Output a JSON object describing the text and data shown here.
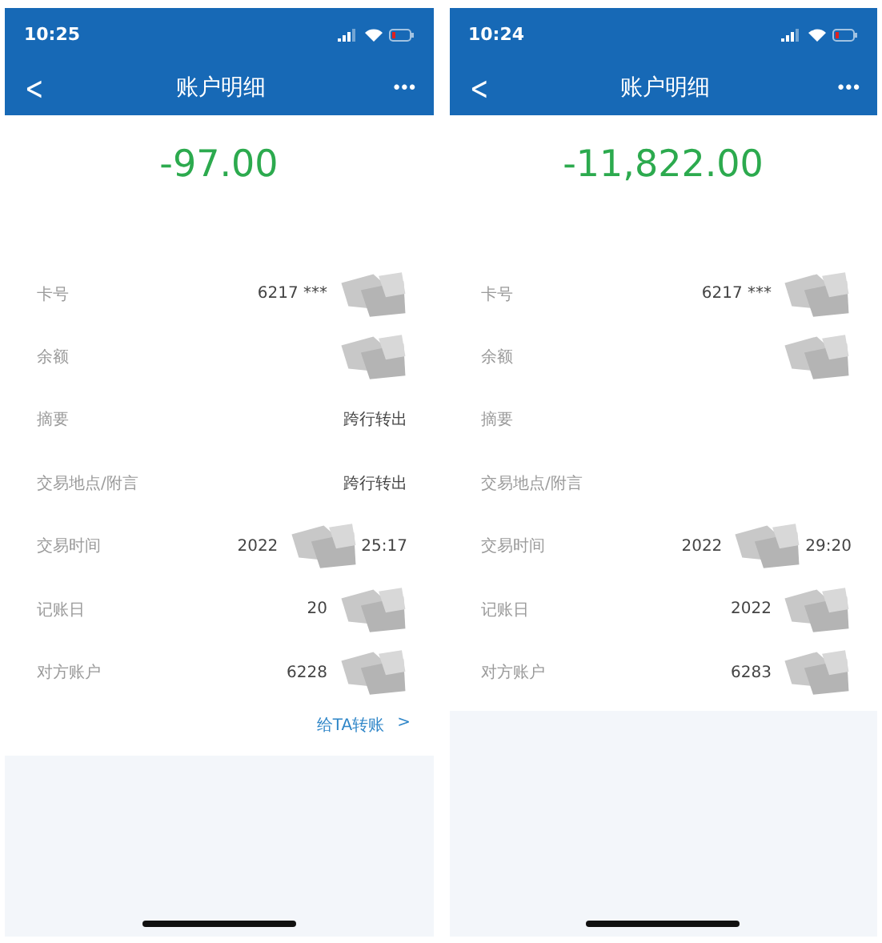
{
  "screens": [
    {
      "status_bar": {
        "time": "10:25",
        "battery_low": true
      },
      "nav": {
        "back": "<",
        "title": "账户明细",
        "more": "•••"
      },
      "amount": "-97.00",
      "rows": [
        {
          "label": "卡号",
          "value": "6217 ***",
          "redacted": true
        },
        {
          "label": "余额",
          "redacted": true
        },
        {
          "label": "摘要",
          "value": "跨行转出"
        },
        {
          "label": "交易地点/附言",
          "value": "跨行转出"
        },
        {
          "label": "交易时间",
          "value": "2022",
          "value_end": "25:17",
          "redacted": true
        },
        {
          "label": "记账日",
          "value": "20",
          "redacted": true
        },
        {
          "label": "对方账户",
          "value": "6228",
          "redacted": true
        }
      ],
      "link": {
        "label": "给TA转账",
        "arrow": ">"
      }
    },
    {
      "status_bar": {
        "time": "10:24",
        "battery_low": true
      },
      "nav": {
        "back": "<",
        "title": "账户明细",
        "more": "•••"
      },
      "amount": "-11,822.00",
      "rows": [
        {
          "label": "卡号",
          "value": "6217 ***",
          "redacted": true
        },
        {
          "label": "余额",
          "redacted": true
        },
        {
          "label": "摘要"
        },
        {
          "label": "交易地点/附言"
        },
        {
          "label": "交易时间",
          "value": "2022",
          "value_end": "29:20",
          "redacted": true
        },
        {
          "label": "记账日",
          "value": "2022",
          "redacted": true
        },
        {
          "label": "对方账户",
          "value": "6283",
          "redacted": true
        }
      ]
    }
  ]
}
